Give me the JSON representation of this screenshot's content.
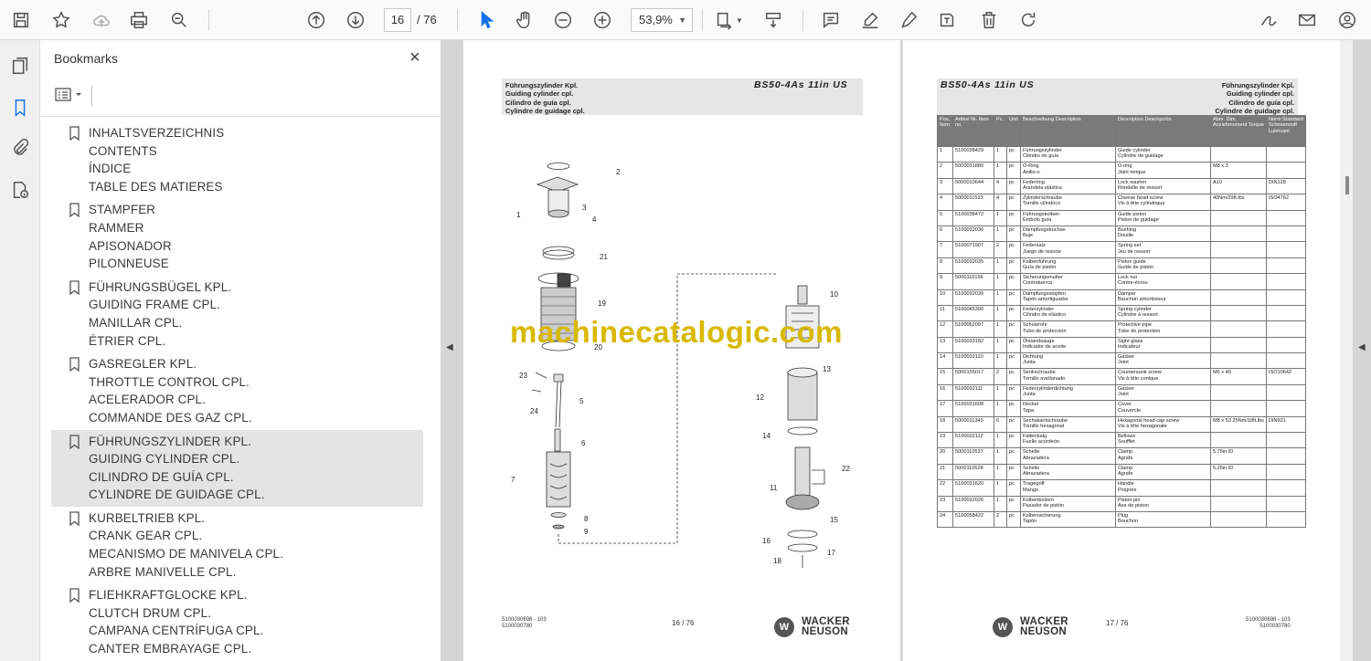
{
  "toolbar": {
    "current_page": "16",
    "total_pages": "/ 76",
    "zoom": "53,9%"
  },
  "bookmarks_panel": {
    "title": "Bookmarks",
    "close": "×",
    "items": [
      {
        "lines": [
          "INHALTSVERZEICHNIS",
          "CONTENTS",
          "ÍNDICE",
          "TABLE DES MATIERES"
        ],
        "selected": false
      },
      {
        "lines": [
          "STAMPFER",
          "RAMMER",
          "APISONADOR",
          "PILONNEUSE"
        ],
        "selected": false
      },
      {
        "lines": [
          "FÜHRUNGSBÜGEL KPL.",
          "GUIDING FRAME CPL.",
          "MANILLAR CPL.",
          "ÉTRIER CPL."
        ],
        "selected": false
      },
      {
        "lines": [
          "GASREGLER KPL.",
          "THROTTLE CONTROL CPL.",
          "ACELERADOR CPL.",
          "COMMANDE DES GAZ CPL."
        ],
        "selected": false
      },
      {
        "lines": [
          "FÜHRUNGSZYLINDER KPL.",
          "GUIDING CYLINDER CPL.",
          "CILINDRO DE GUÍA CPL.",
          "CYLINDRE DE GUIDAGE CPL."
        ],
        "selected": true
      },
      {
        "lines": [
          "KURBELTRIEB KPL.",
          "CRANK GEAR CPL.",
          "MECANISMO DE MANIVELA CPL.",
          "ARBRE MANIVELLE CPL."
        ],
        "selected": false
      },
      {
        "lines": [
          "FLIEHKRAFTGLOCKE KPL.",
          "CLUTCH DRUM CPL.",
          "CAMPANA CENTRÍFUGA CPL.",
          "CANTER EMBRAYAGE CPL."
        ],
        "selected": false
      }
    ]
  },
  "left_page": {
    "header_lines": [
      "Führungszylinder Kpl.",
      "Guiding cylinder cpl.",
      "Cilindro de guía cpl.",
      "Cylindre de guidage cpl."
    ],
    "model": "BS50-4As 11in US",
    "footer_codes": [
      "5100030698 - 103",
      "5100030780"
    ],
    "page_number": "16 / 76",
    "logo": [
      "WACKER",
      "NEUSON"
    ],
    "diagram_labels": [
      "1",
      "2",
      "3",
      "4",
      "5",
      "6",
      "7",
      "8",
      "9",
      "10",
      "11",
      "12",
      "13",
      "14",
      "15",
      "16",
      "17",
      "18",
      "19",
      "20",
      "21",
      "22",
      "23",
      "24"
    ]
  },
  "watermark": "machinecatalogic.com",
  "right_page": {
    "model": "BS50-4As 11in US",
    "header_lines": [
      "Führungszylinder Kpl.",
      "Guiding cylinder cpl.",
      "Cilindro de guía cpl.",
      "Cylindre de guidage cpl."
    ],
    "footer_codes": [
      "5100030698 - 103",
      "5100030780"
    ],
    "page_number": "17 / 76",
    "logo": [
      "WACKER",
      "NEUSON"
    ],
    "table_headers": [
      "Pos. Item",
      "Artikel Nr. Item no.",
      "Pc.",
      "Unit",
      "Beschreibung Description",
      "Description Descripción",
      "Abm. Dim. Anziehmoment Torque",
      "Norm Standard Schmierstoff Lubricant"
    ],
    "rows": [
      [
        "1",
        "5100038429",
        "1",
        "pc",
        "Führungszylinder",
        "Cilindro de guía",
        "Guide cylinder",
        "Cylindre de guidage",
        "",
        ""
      ],
      [
        "2",
        "5000031880",
        "1",
        "pc",
        "O-Ring",
        "Anillo-o",
        "O-ring",
        "Joint torique",
        "M8 x 3",
        ""
      ],
      [
        "3",
        "5000010644",
        "4",
        "pc",
        "Federring",
        "Arandela elástica",
        "Lock washer",
        "Rondelle de ressort",
        "A10",
        "DIN128"
      ],
      [
        "4",
        "5000011533",
        "4",
        "pc",
        "Zylinderschraube",
        "Tornillo cilíndrico",
        "Cheese head screw",
        "Vis à tête cylindrique",
        "40Nm/29ft.lbs",
        "ISO4762"
      ],
      [
        "5",
        "5100038472",
        "1",
        "pc",
        "Führungskolben",
        "Émbolo guía",
        "Guide piston",
        "Piston de guidage",
        "",
        ""
      ],
      [
        "6",
        "5100032036",
        "1",
        "pc",
        "Dämpfungsbüchse",
        "Buje",
        "Bushing",
        "Douille",
        "",
        ""
      ],
      [
        "7",
        "5100071907",
        "2",
        "pc",
        "Federsatz",
        "Juego de resorte",
        "Spring set",
        "Jeu de ressort",
        "",
        ""
      ],
      [
        "8",
        "5100032035",
        "1",
        "pc",
        "Kolbenführung",
        "Guía de pistón",
        "Piston guide",
        "Guide de piston",
        "",
        ""
      ],
      [
        "9",
        "5000110196",
        "1",
        "pc",
        "Sicherungsmutter",
        "Contratuerca",
        "Lock nut",
        "Contre-écrou",
        "",
        ""
      ],
      [
        "10",
        "5100032039",
        "1",
        "pc",
        "Dämpfungsstopfen",
        "Tapón amortiguador",
        "Damper",
        "Bouchon amortisseur",
        "",
        ""
      ],
      [
        "11",
        "5100045300",
        "1",
        "pc",
        "Federzylinder",
        "Cilindro de elástico",
        "Spring cylinder",
        "Cylindre à ressort",
        "",
        ""
      ],
      [
        "12",
        "5100052097",
        "1",
        "pc",
        "Schutzrohr",
        "Tubo de protección",
        "Protective pipe",
        "Tube de protection",
        "",
        ""
      ],
      [
        "13",
        "5100033182",
        "1",
        "pc",
        "Ölstandsauge",
        "Indicador de aceite",
        "Sight glass",
        "Indicateur",
        "",
        ""
      ],
      [
        "14",
        "5100032110",
        "1",
        "pc",
        "Dichtung",
        "Junta",
        "Gasket",
        "Joint",
        "",
        ""
      ],
      [
        "15",
        "5000155017",
        "2",
        "pc",
        "Senkschraube",
        "Tornillo avellanado",
        "Countersunk screw",
        "Vis à tête conique",
        "M6 x 40",
        "ISO10642"
      ],
      [
        "16",
        "5100032111",
        "1",
        "pc",
        "Federzylinderdichtung",
        "Junta",
        "Gasket",
        "Joint",
        "",
        ""
      ],
      [
        "17",
        "5100031608",
        "1",
        "pc",
        "Deckel",
        "Tapa",
        "Cover",
        "Couvercle",
        "",
        ""
      ],
      [
        "18",
        "5000011343",
        "6",
        "pc",
        "Sechskantschraube",
        "Tornillo hexagonal",
        "Hexagonal head cap screw",
        "Vis à tête hexagonale",
        "M8 x 53  25Nm/18ft.lbs",
        "DIN931"
      ],
      [
        "19",
        "5100032112",
        "1",
        "pc",
        "Faltenbalg",
        "Fuelle acordeón",
        "Bellows",
        "Soufflet",
        "",
        ""
      ],
      [
        "20",
        "5000110537",
        "1",
        "pc",
        "Schelle",
        "Abrazadera",
        "Clamp",
        "Agrafe",
        "5,75in ID",
        ""
      ],
      [
        "21",
        "5000110528",
        "1",
        "pc",
        "Schelle",
        "Abrazadera",
        "Clamp",
        "Agrafe",
        "5,25in ID",
        ""
      ],
      [
        "22",
        "5100031620",
        "1",
        "pc",
        "Tragegriff",
        "Mango",
        "Handle",
        "Poignée",
        "",
        ""
      ],
      [
        "23",
        "5100032026",
        "1",
        "pc",
        "Kolbenbolzen",
        "Pasador de pistón",
        "Piston pin",
        "Axe de piston",
        "",
        ""
      ],
      [
        "24",
        "5100058422",
        "2",
        "pc",
        "Kolbensicherung",
        "Tapón",
        "Plug",
        "Bouchon",
        "",
        ""
      ]
    ]
  }
}
